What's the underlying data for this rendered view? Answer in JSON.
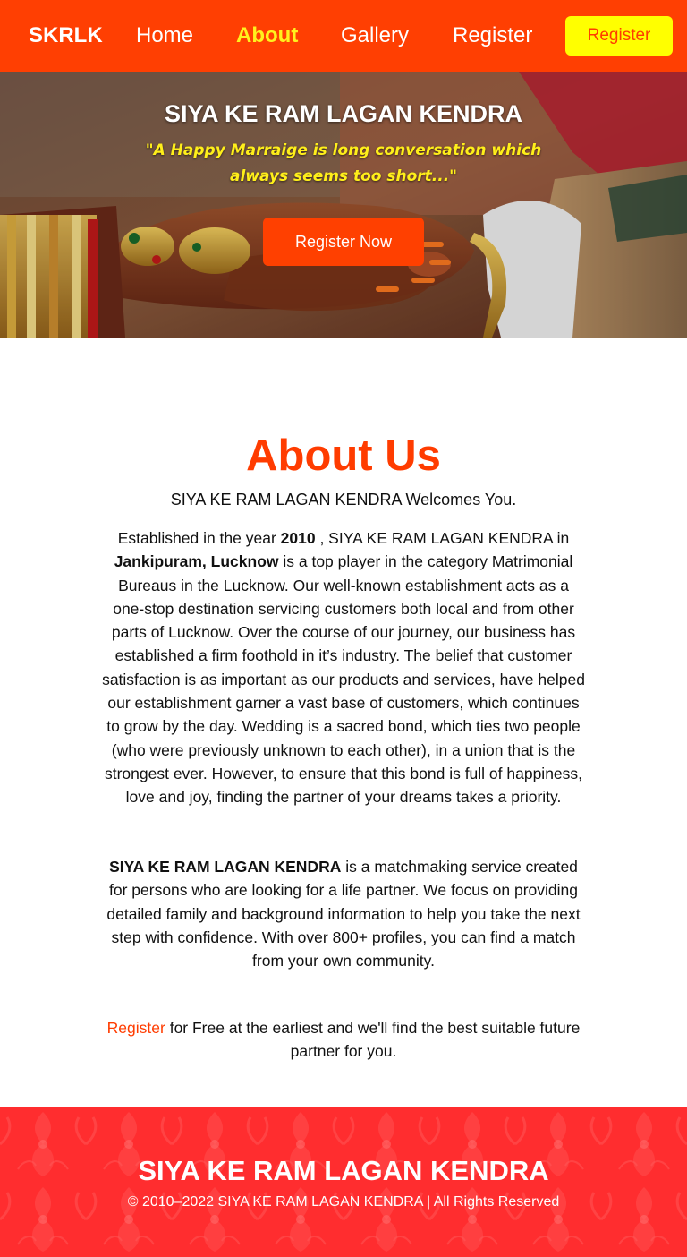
{
  "navbar": {
    "brand": "SKRLK",
    "links": [
      {
        "label": "Home"
      },
      {
        "label": "About",
        "active": true
      },
      {
        "label": "Gallery"
      },
      {
        "label": "Register"
      }
    ],
    "register_button": "Register"
  },
  "hero": {
    "title": "SIYA KE RAM LAGAN KENDRA",
    "quote": "\"A Happy Marraige is long conversation which always seems too short...\"",
    "cta": "Register Now"
  },
  "about": {
    "heading": "About Us",
    "welcome": "SIYA KE RAM LAGAN KENDRA Welcomes You.",
    "p1": {
      "t1": "Established in the year ",
      "year": "2010",
      "t2": " , SIYA KE RAM LAGAN KENDRA in ",
      "location": "Jankipuram, Lucknow",
      "t3": " is a top player in the category Matrimonial Bureaus in the Lucknow. Our well-known establishment acts as a one-stop destination servicing customers both local and from other parts of Lucknow. Over the course of our journey, our business has established a firm foothold in it’s industry. The belief that customer satisfaction is as important as our products and services, have helped our establishment garner a vast base of customers, which continues to grow by the day. Wedding is a sacred bond, which ties two people (who were previously unknown to each other), in a union that is the strongest ever. However, to ensure that this bond is full of happiness, love and joy, finding the partner of your dreams takes a priority."
    },
    "p2": {
      "name": "SIYA KE RAM LAGAN KENDRA",
      "text": " is a matchmaking service created for persons who are looking for a life partner. We focus on providing detailed family and background information to help you take the next step with confidence. With over 800+ profiles, you can find a match from your own community."
    },
    "p3": {
      "link": "Register",
      "text": " for Free at the earliest and we'll find the best suitable future partner for you."
    }
  },
  "footer": {
    "title": "SIYA KE RAM LAGAN KENDRA",
    "copyright": "© 2010–2022 SIYA KE RAM LAGAN KENDRA | All Rights Reserved"
  },
  "colors": {
    "primary": "#ff3f02",
    "accent": "#fff11e",
    "footer": "#ff2d2f"
  }
}
